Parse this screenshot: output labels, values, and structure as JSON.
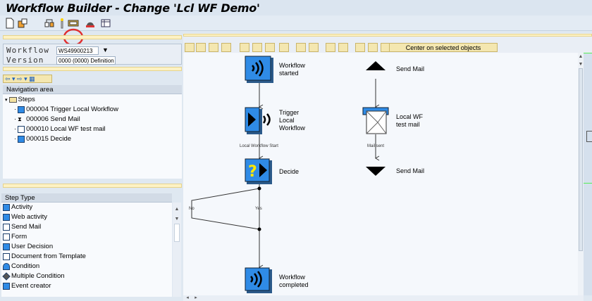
{
  "window": {
    "title": "Workflow Builder - Change 'Lcl WF Demo'"
  },
  "toolbar": {
    "icons": [
      "new-icon",
      "copy-icon",
      "link-icon",
      "wand-icon",
      "step-editor-icon",
      "bell-icon",
      "table-icon"
    ],
    "highlighted": "step-editor-icon",
    "highlight_color": "#e03030"
  },
  "header_form": {
    "workflow_label": "Workflow",
    "workflow_value": "WS49900213",
    "version_label": "Version",
    "version_value": "0000 (0000) Definition"
  },
  "navigation": {
    "title": "Navigation area",
    "root": "Steps",
    "items": [
      "000004 Trigger Local Workflow",
      "000006 Send Mail",
      "000010 Local WF test mail",
      "000015 Decide"
    ]
  },
  "step_types": {
    "title": "Step Type",
    "items": [
      "Activity",
      "Web activity",
      "Send Mail",
      "Form",
      "User Decision",
      "Document from Template",
      "Condition",
      "Multiple Condition",
      "Event creator"
    ]
  },
  "graphic_toolbar": {
    "center_button": "Center on selected objects"
  },
  "diagram": {
    "nodes": {
      "start": "Workflow started",
      "trigger": "Trigger Local Workflow",
      "decide": "Decide",
      "end": "Workflow completed",
      "send_mail_top": "Send Mail",
      "local_mail": "Local WF test mail",
      "send_mail_bottom": "Send Mail"
    },
    "edges": {
      "trigger_out": "Local Workflow Start",
      "mail_out": "Mail sent",
      "no": "No",
      "yes": "Yes"
    }
  },
  "colors": {
    "node_blue": "#2f8be6",
    "yellow_bar": "#fdf2c4",
    "canvas": "#f5f8fc"
  }
}
